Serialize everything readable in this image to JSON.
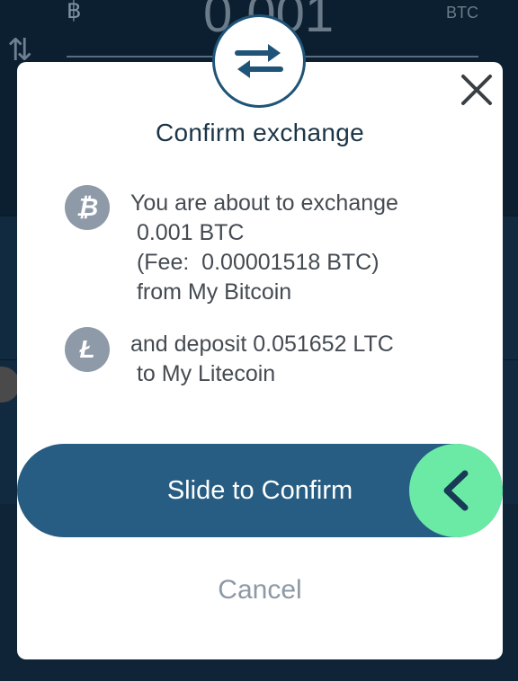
{
  "background": {
    "currency_symbol": "฿",
    "amount": "0.001",
    "unit": "BTC"
  },
  "dialog": {
    "title": "Confirm exchange",
    "from": {
      "icon": "bitcoin-icon",
      "line1": "You are about to exchange",
      "line2": " 0.001 BTC",
      "line3": " (Fee:  0.00001518 BTC)",
      "line4": " from My Bitcoin"
    },
    "to": {
      "icon": "litecoin-icon",
      "line1": "and deposit 0.051652 LTC",
      "line2": " to My Litecoin"
    },
    "slider_label": "Slide to Confirm",
    "cancel_label": "Cancel"
  },
  "colors": {
    "primary": "#275d83",
    "accent": "#6beaa6",
    "muted": "#8d99a5",
    "title": "#1b3446"
  }
}
